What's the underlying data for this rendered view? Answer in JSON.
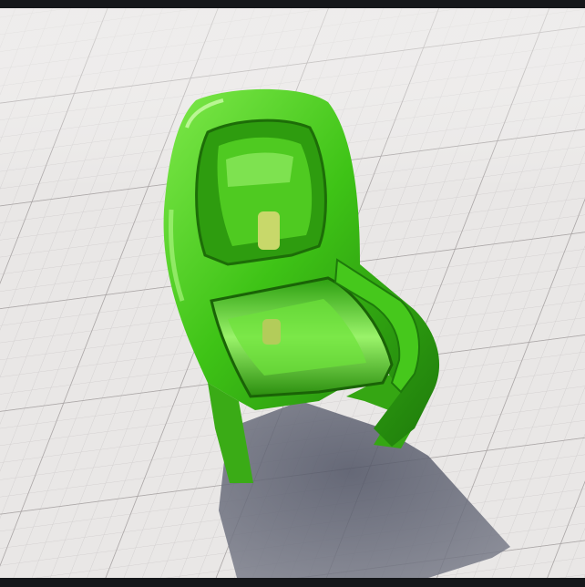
{
  "scene": {
    "subject": "green-glass-armchair",
    "floor": "white-grid-tile-floor",
    "colors": {
      "floor_base": "#e9e7e6",
      "floor_line": "#cfcccc",
      "floor_major_line": "#b8b4b4",
      "chair_green": "#3ec316",
      "chair_dark": "#1f7a0c",
      "chair_light": "#8ff25a",
      "shadow": "#5e6170",
      "frame_dark": "#15171a"
    }
  }
}
